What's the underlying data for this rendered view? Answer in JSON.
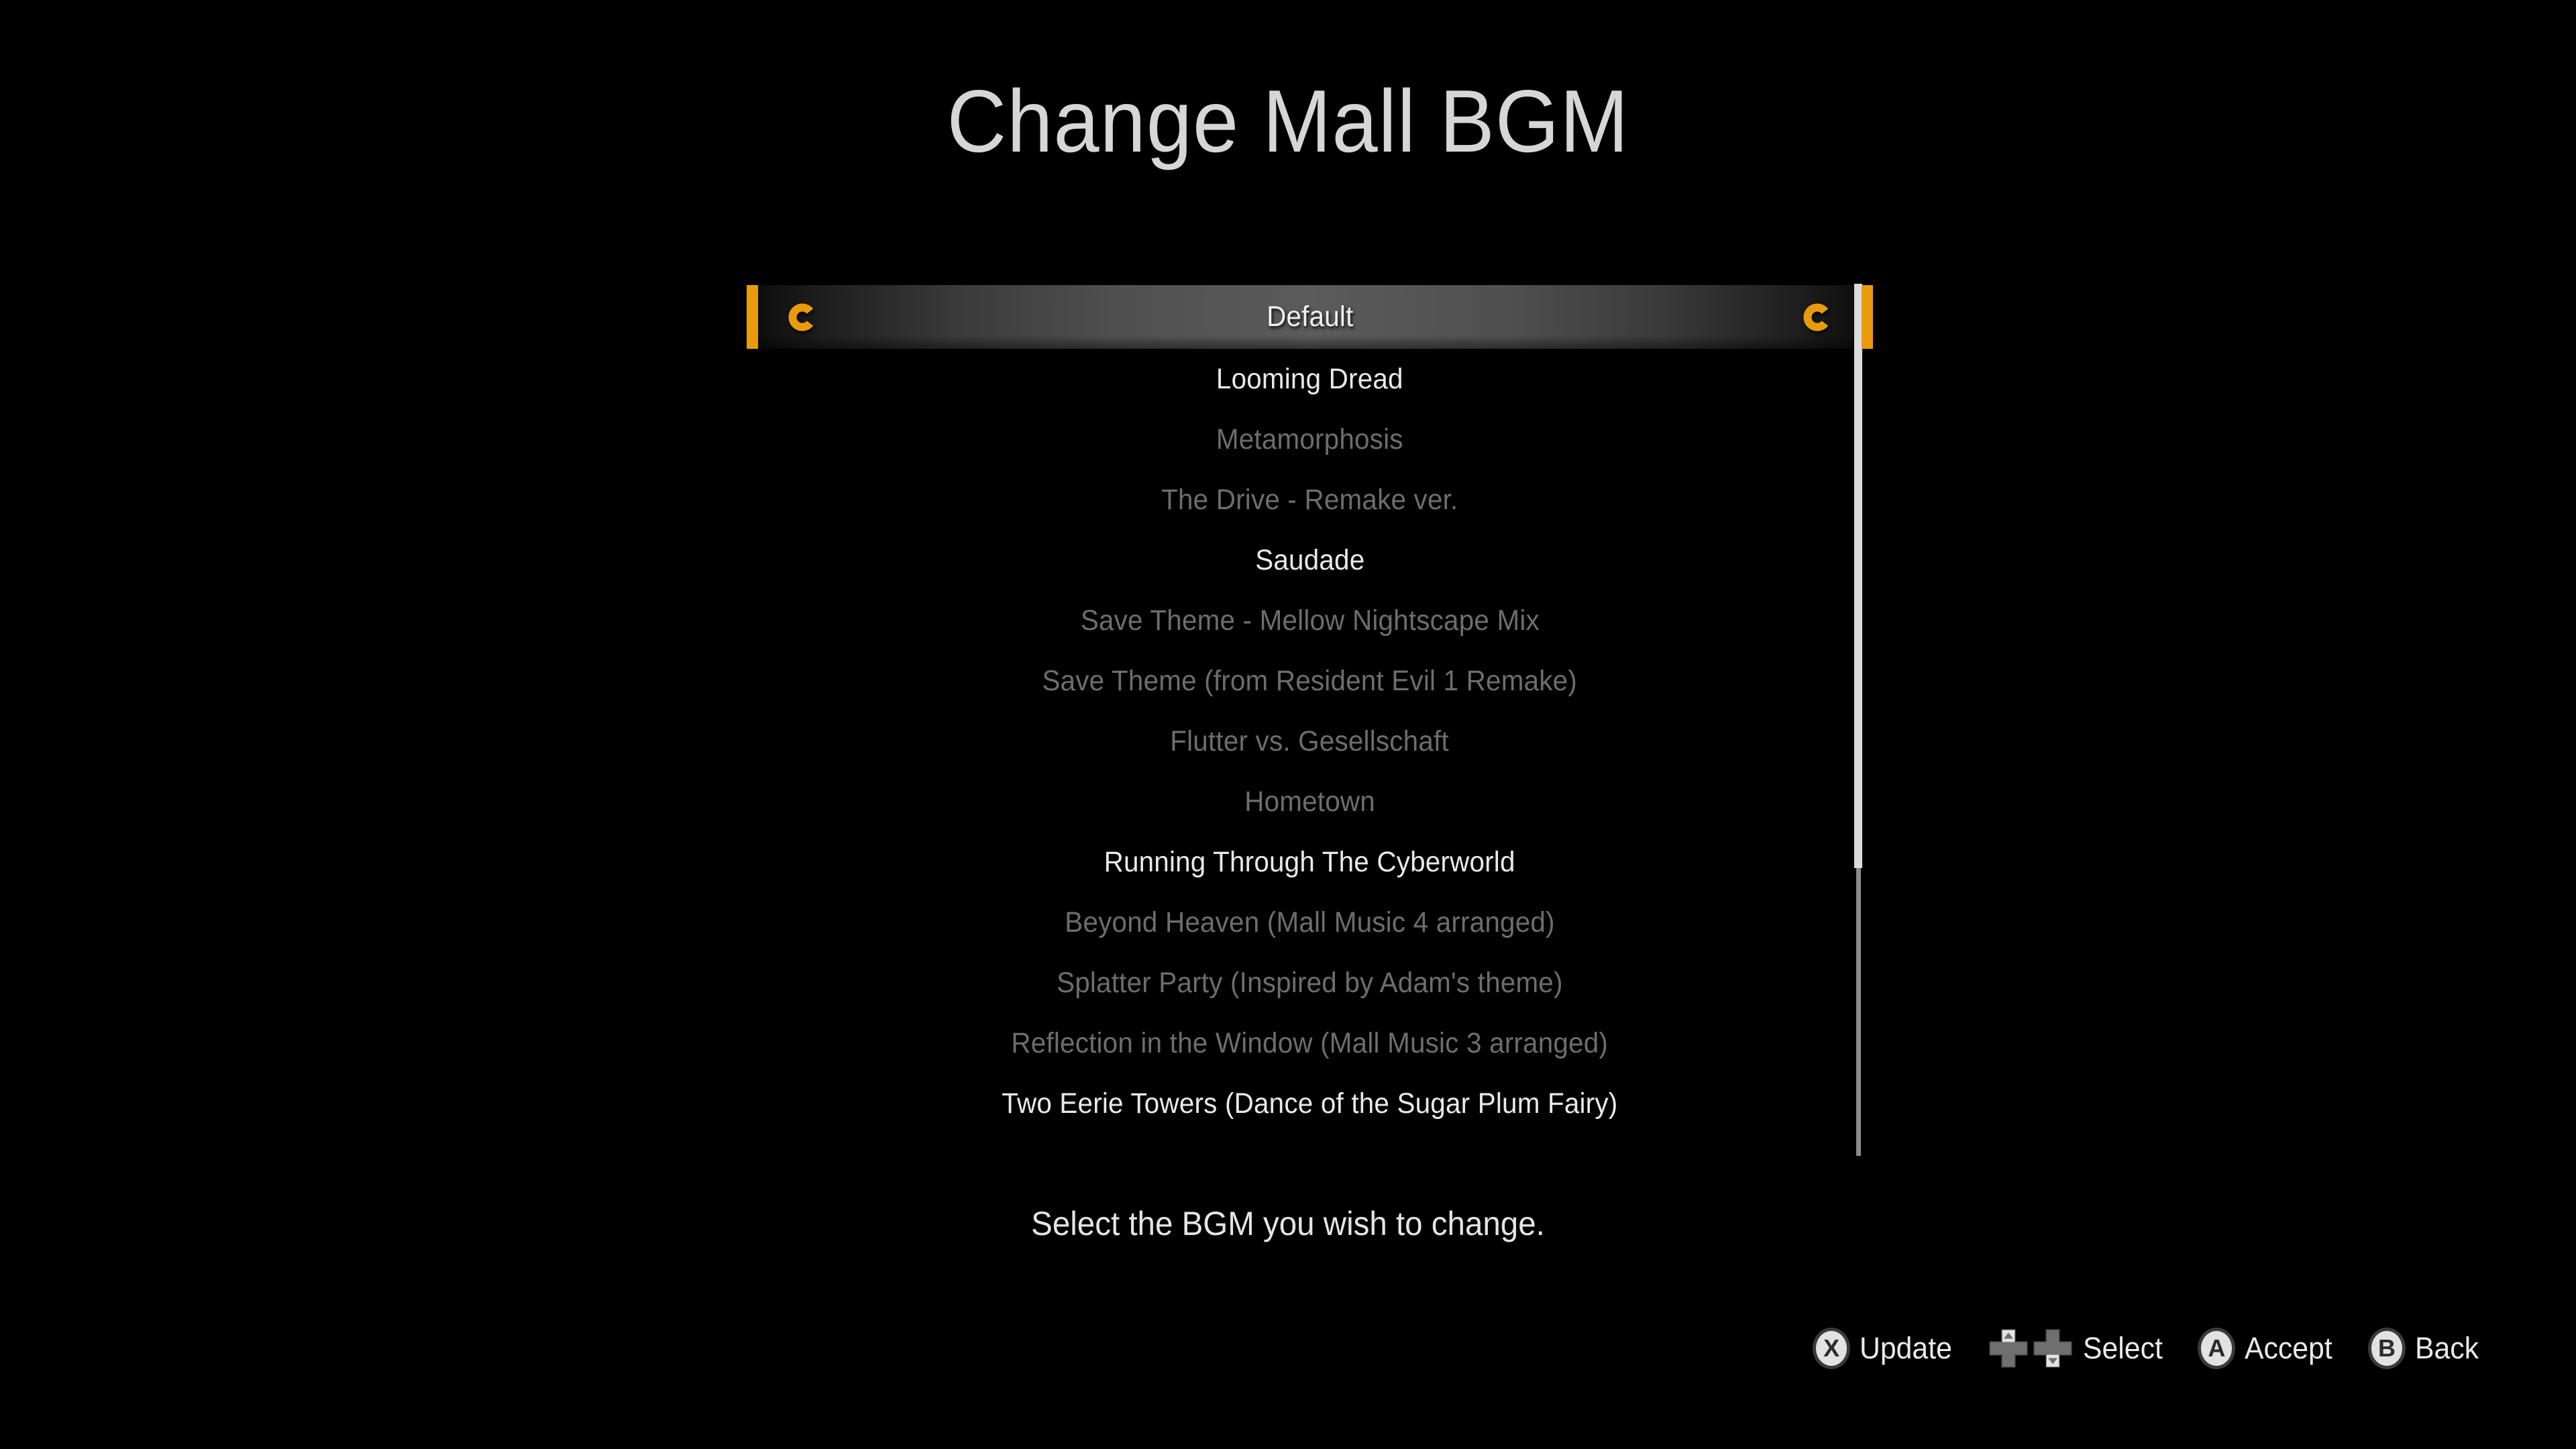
{
  "screen": {
    "title": "Change Mall BGM",
    "hint": "Select the BGM you wish to change.",
    "accent_color": "#E89C0C",
    "available_text_color": "#e9e9e9",
    "locked_text_color": "#6d6d6d",
    "background_color": "#000000"
  },
  "list": {
    "selected_index": 0,
    "items": [
      {
        "label": "Default",
        "state": "selected"
      },
      {
        "label": "Looming Dread",
        "state": "available"
      },
      {
        "label": "Metamorphosis",
        "state": "locked"
      },
      {
        "label": "The Drive - Remake ver.",
        "state": "locked"
      },
      {
        "label": "Saudade",
        "state": "available"
      },
      {
        "label": "Save Theme - Mellow Nightscape Mix",
        "state": "locked"
      },
      {
        "label": "Save Theme (from Resident Evil 1 Remake)",
        "state": "locked"
      },
      {
        "label": "Flutter vs. Gesellschaft",
        "state": "locked"
      },
      {
        "label": "Hometown",
        "state": "locked"
      },
      {
        "label": "Running Through The Cyberworld",
        "state": "available"
      },
      {
        "label": "Beyond Heaven (Mall Music 4 arranged)",
        "state": "locked"
      },
      {
        "label": "Splatter Party (Inspired by Adam's theme)",
        "state": "locked"
      },
      {
        "label": "Reflection in the Window (Mall Music 3 arranged)",
        "state": "locked"
      },
      {
        "label": "Two Eerie Towers (Dance of the Sugar Plum Fairy)",
        "state": "available"
      }
    ]
  },
  "scrollbar": {
    "thumb_fraction": 0.67,
    "thumb_position": "top"
  },
  "cursor": {
    "left_glyph": "c-cursor-icon",
    "right_glyph": "c-cursor-icon"
  },
  "prompts": [
    {
      "button": "X",
      "glyph": "x-button-icon",
      "label": "Update"
    },
    {
      "button": "DPAD",
      "glyph": "dpad-updown-icon",
      "label": "Select"
    },
    {
      "button": "A",
      "glyph": "a-button-icon",
      "label": "Accept"
    },
    {
      "button": "B",
      "glyph": "b-button-icon",
      "label": "Back"
    }
  ]
}
